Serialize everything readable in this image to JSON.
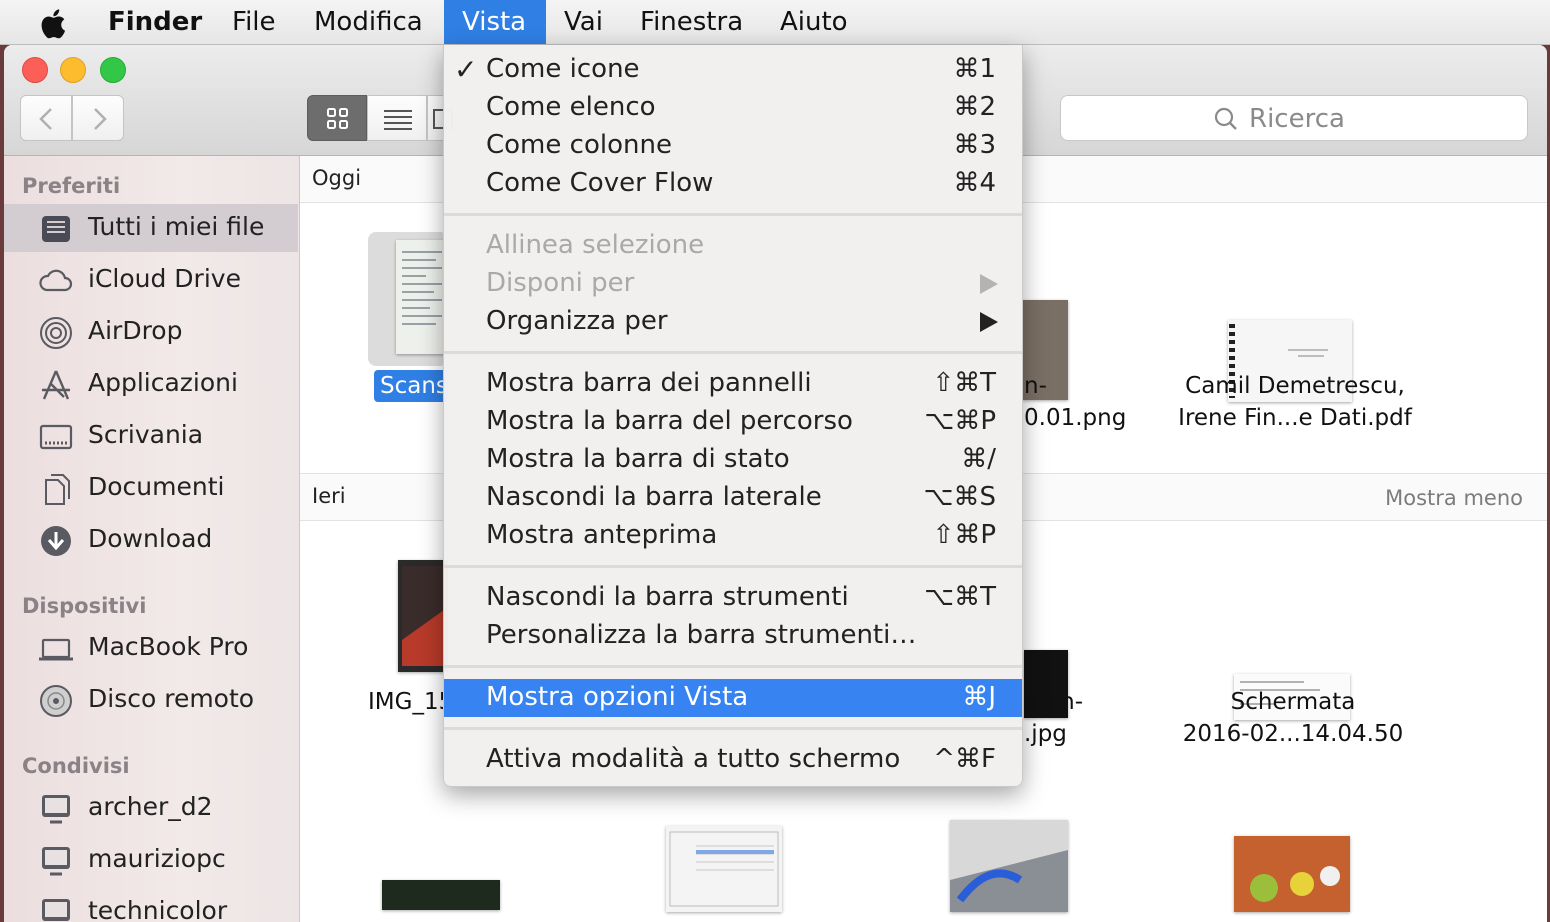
{
  "menubar": {
    "app": "Finder",
    "items": [
      "File",
      "Modifica",
      "Vista",
      "Vai",
      "Finestra",
      "Aiuto"
    ],
    "active": "Vista"
  },
  "toolbar": {
    "search_placeholder": "Ricerca"
  },
  "sidebar": {
    "sections": [
      {
        "title": "Preferiti",
        "items": [
          {
            "label": "Tutti i miei file",
            "icon": "all-files-icon",
            "selected": true
          },
          {
            "label": "iCloud Drive",
            "icon": "cloud-icon"
          },
          {
            "label": "AirDrop",
            "icon": "airdrop-icon"
          },
          {
            "label": "Applicazioni",
            "icon": "applications-icon"
          },
          {
            "label": "Scrivania",
            "icon": "desktop-icon"
          },
          {
            "label": "Documenti",
            "icon": "documents-icon"
          },
          {
            "label": "Download",
            "icon": "download-icon"
          }
        ]
      },
      {
        "title": "Dispositivi",
        "items": [
          {
            "label": "MacBook Pro",
            "icon": "laptop-icon"
          },
          {
            "label": "Disco remoto",
            "icon": "disc-icon"
          }
        ]
      },
      {
        "title": "Condivisi",
        "items": [
          {
            "label": "archer_d2",
            "icon": "network-computer-icon"
          },
          {
            "label": "mauriziopc",
            "icon": "network-computer-icon"
          },
          {
            "label": "technicolor",
            "icon": "network-computer-icon"
          }
        ]
      }
    ]
  },
  "content": {
    "groups": [
      {
        "title": "Oggi",
        "action": ""
      },
      {
        "title": "Ieri",
        "action": "Mostra meno"
      }
    ],
    "files_today": [
      {
        "name": "Scans",
        "selected": true
      },
      {
        "name_line1": "n-",
        "name_line2": "0.01.png"
      },
      {
        "name_line1": "Camil Demetrescu,",
        "name_line2": "Irene Fin...e Dati.pdf"
      }
    ],
    "files_yesterday": [
      {
        "name": "IMG_15"
      },
      {
        "name_line1": "k-on-",
        "name_line2": ".jpg"
      },
      {
        "name_line1": "Schermata",
        "name_line2": "2016-02...14.04.50"
      }
    ]
  },
  "vista_menu": {
    "group1": [
      {
        "label": "Come icone",
        "shortcut": "⌘1",
        "checked": true
      },
      {
        "label": "Come elenco",
        "shortcut": "⌘2"
      },
      {
        "label": "Come colonne",
        "shortcut": "⌘3"
      },
      {
        "label": "Come Cover Flow",
        "shortcut": "⌘4"
      }
    ],
    "group2": [
      {
        "label": "Allinea selezione",
        "disabled": true
      },
      {
        "label": "Disponi per",
        "disabled": true,
        "submenu": true
      },
      {
        "label": "Organizza per",
        "submenu": true
      }
    ],
    "group3": [
      {
        "label": "Mostra barra dei pannelli",
        "shortcut": "⇧⌘T"
      },
      {
        "label": "Mostra la barra del percorso",
        "shortcut": "⌥⌘P"
      },
      {
        "label": "Mostra la barra di stato",
        "shortcut": "⌘/"
      },
      {
        "label": "Nascondi la barra laterale",
        "shortcut": "⌥⌘S"
      },
      {
        "label": "Mostra anteprima",
        "shortcut": "⇧⌘P"
      }
    ],
    "group4": [
      {
        "label": "Nascondi la barra strumenti",
        "shortcut": "⌥⌘T"
      },
      {
        "label": "Personalizza la barra strumenti…",
        "shortcut": ""
      }
    ],
    "group5": [
      {
        "label": "Mostra opzioni Vista",
        "shortcut": "⌘J",
        "highlighted": true
      }
    ],
    "group6": [
      {
        "label": "Attiva modalità a tutto schermo",
        "shortcut": "^⌘F"
      }
    ]
  },
  "colors": {
    "accent": "#3683f1",
    "menubar_active": "#2f7fe4",
    "close": "#fc5f57",
    "minimize": "#fdbc2e",
    "zoom": "#33c748"
  }
}
